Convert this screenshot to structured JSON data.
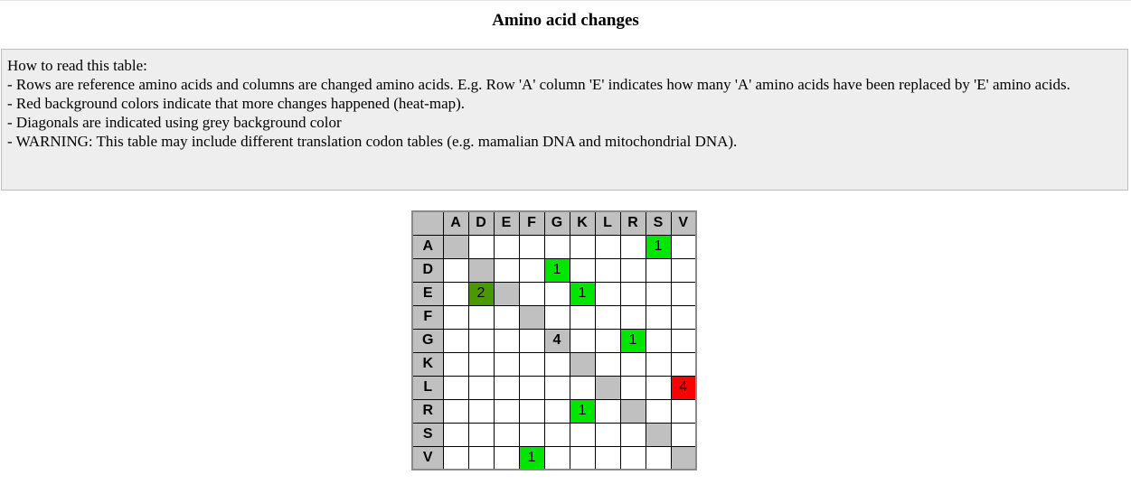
{
  "page": {
    "title": "Amino acid changes"
  },
  "help": {
    "heading": "How to read this table:",
    "lines": [
      "- Rows are reference amino acids and columns are changed amino acids. E.g. Row 'A' column 'E' indicates how many 'A' amino acids have been replaced by 'E' amino acids.",
      "- Red background colors indicate that more changes happened (heat-map).",
      "- Diagonals are indicated using grey background color",
      "- WARNING: This table may include different translation codon tables (e.g. mamalian DNA and mitochondrial DNA)."
    ]
  },
  "matrix": {
    "columns": [
      "A",
      "D",
      "E",
      "F",
      "G",
      "K",
      "L",
      "R",
      "S",
      "V"
    ],
    "rows": [
      {
        "label": "A",
        "cells": [
          "",
          "",
          "",
          "",
          "",
          "",
          "",
          "",
          "1",
          ""
        ]
      },
      {
        "label": "D",
        "cells": [
          "",
          "",
          "",
          "",
          "1",
          "",
          "",
          "",
          "",
          ""
        ]
      },
      {
        "label": "E",
        "cells": [
          "",
          "2",
          "",
          "",
          "",
          "1",
          "",
          "",
          "",
          ""
        ]
      },
      {
        "label": "F",
        "cells": [
          "",
          "",
          "",
          "",
          "",
          "",
          "",
          "",
          "",
          ""
        ]
      },
      {
        "label": "G",
        "cells": [
          "",
          "",
          "",
          "",
          "4",
          "",
          "",
          "1",
          "",
          ""
        ]
      },
      {
        "label": "K",
        "cells": [
          "",
          "",
          "",
          "",
          "",
          "",
          "",
          "",
          "",
          ""
        ]
      },
      {
        "label": "L",
        "cells": [
          "",
          "",
          "",
          "",
          "",
          "",
          "",
          "",
          "",
          "4"
        ]
      },
      {
        "label": "R",
        "cells": [
          "",
          "",
          "",
          "",
          "",
          "1",
          "",
          "",
          "",
          ""
        ]
      },
      {
        "label": "S",
        "cells": [
          "",
          "",
          "",
          "",
          "",
          "",
          "",
          "",
          "",
          ""
        ]
      },
      {
        "label": "V",
        "cells": [
          "",
          "",
          "",
          "1",
          "",
          "",
          "",
          "",
          "",
          ""
        ]
      }
    ],
    "colors": {
      "header": "#c0c0c0",
      "diagonal": "#c0c0c0",
      "empty": "#ffffff",
      "heat_low": "#00e600",
      "heat_mid": "#4b9900",
      "heat_high": "#ff0000",
      "border": "#000000"
    },
    "heat_levels": [
      {
        "value": 1,
        "color": "#00e600"
      },
      {
        "value": 2,
        "color": "#4b9900"
      },
      {
        "value": 4,
        "color": "#ff0000"
      }
    ]
  }
}
